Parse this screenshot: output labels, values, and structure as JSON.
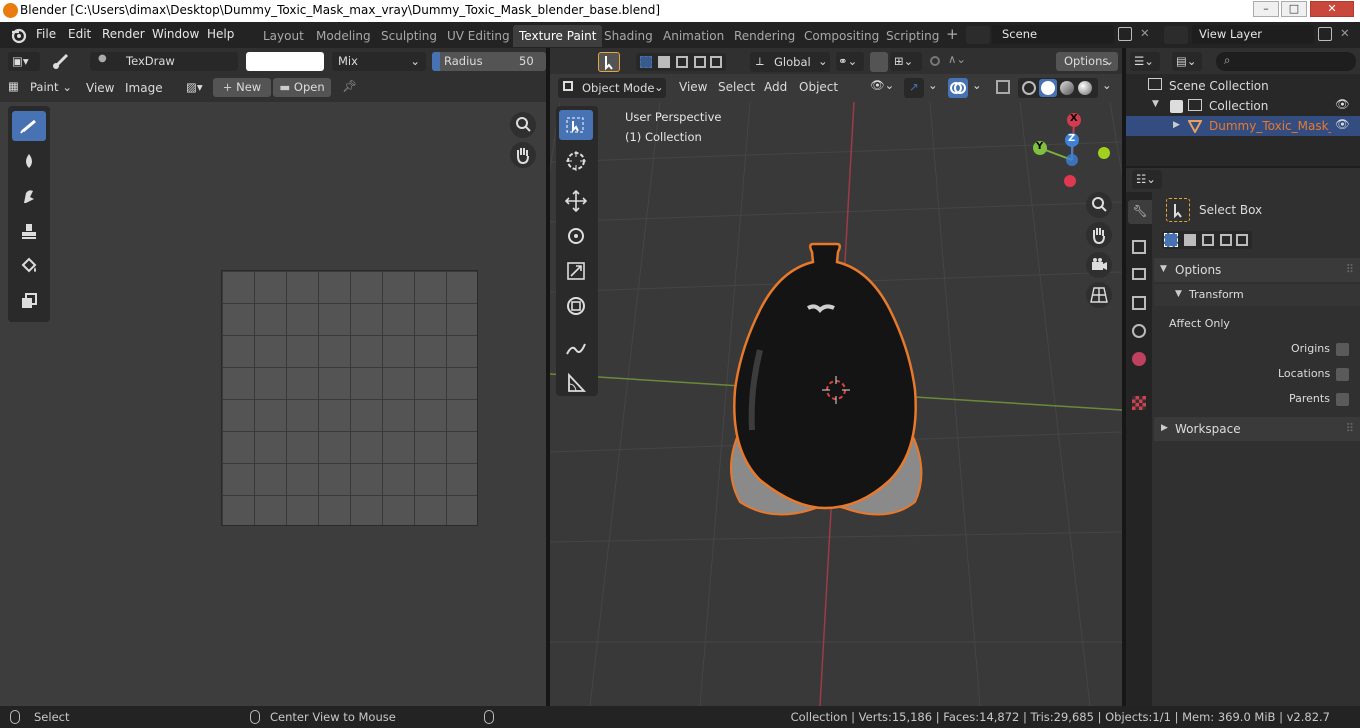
{
  "window": {
    "title": "Blender [C:\\Users\\dimax\\Desktop\\Dummy_Toxic_Mask_max_vray\\Dummy_Toxic_Mask_blender_base.blend]",
    "buttons": [
      "–",
      "□",
      "✕"
    ]
  },
  "menu": [
    "File",
    "Edit",
    "Render",
    "Window",
    "Help"
  ],
  "workspaces": [
    "Layout",
    "Modeling",
    "Sculpting",
    "UV Editing",
    "Texture Paint",
    "Shading",
    "Animation",
    "Rendering",
    "Compositing",
    "Scripting"
  ],
  "active_workspace": "Texture Paint",
  "scene": {
    "name": "Scene",
    "view_layer": "View Layer"
  },
  "image_editor": {
    "brush": "TexDraw",
    "blend": "Mix",
    "radius_label": "Radius",
    "radius_value": "50 px",
    "mode": "Paint",
    "menus": [
      "View",
      "Image"
    ],
    "new_label": "New",
    "open_label": "Open"
  },
  "viewport": {
    "mode": "Object Mode",
    "menus": [
      "View",
      "Select",
      "Add",
      "Object"
    ],
    "orientation": "Global",
    "options_label": "Options",
    "overlay_line1": "User Perspective",
    "overlay_line2": "(1) Collection",
    "gizmo": {
      "x": "X",
      "y": "Y",
      "z": "Z"
    }
  },
  "outliner": {
    "scene_collection": "Scene Collection",
    "collection": "Collection",
    "object": "Dummy_Toxic_Mask_obj"
  },
  "properties": {
    "tool_name": "Select Box",
    "options_label": "Options",
    "transform_label": "Transform",
    "affect_only": "Affect Only",
    "origins": "Origins",
    "locations": "Locations",
    "parents": "Parents",
    "workspace_label": "Workspace"
  },
  "status": {
    "select": "Select",
    "center": "Center View to Mouse",
    "stats": "Collection | Verts:15,186 | Faces:14,872 | Tris:29,685 | Objects:1/1 | Mem: 369.0 MiB | v2.82.7"
  },
  "colors": {
    "accent": "#4772b3",
    "selection": "#e8792b",
    "active_tab": "#3e3e3e"
  }
}
